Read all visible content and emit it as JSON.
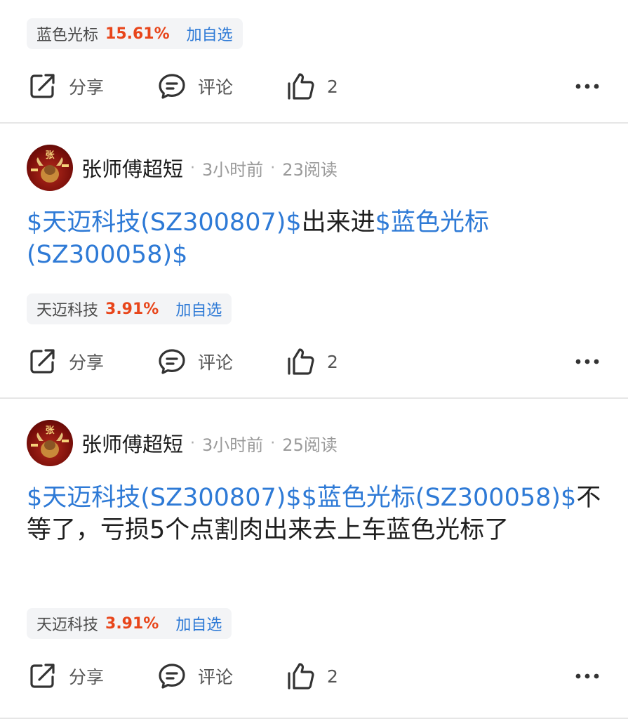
{
  "posts": [
    {
      "stock": {
        "name": "蓝色光标",
        "change": "15.61%",
        "add_label": "加自选"
      },
      "actions": {
        "share": "分享",
        "comment": "评论",
        "likes": "2"
      }
    },
    {
      "author": "张师傅超短",
      "avatar_char": "张",
      "time": "3小时前",
      "reads": "23阅读",
      "content": {
        "link1": "$天迈科技(SZ300807)$",
        "text1": "出来进",
        "link2": "$蓝色光标(SZ300058)$"
      },
      "stock": {
        "name": "天迈科技",
        "change": "3.91%",
        "add_label": "加自选"
      },
      "actions": {
        "share": "分享",
        "comment": "评论",
        "likes": "2"
      }
    },
    {
      "author": "张师傅超短",
      "avatar_char": "张",
      "time": "3小时前",
      "reads": "25阅读",
      "content": {
        "link1": "$天迈科技(SZ300807)$",
        "link2": "$蓝色光标(SZ300058)$",
        "text1": "不等了，亏损5个点割肉出来去上车蓝色光标了"
      },
      "stock": {
        "name": "天迈科技",
        "change": "3.91%",
        "add_label": "加自选"
      },
      "actions": {
        "share": "分享",
        "comment": "评论",
        "likes": "2"
      }
    }
  ],
  "meta_separator": "·",
  "colors": {
    "link": "#2e7ad6",
    "gain": "#e8451a",
    "tag_bg": "#f3f4f6",
    "divider": "#e6e6e6"
  },
  "icons": [
    "share-icon",
    "comment-icon",
    "thumbs-up-icon",
    "more-icon"
  ]
}
